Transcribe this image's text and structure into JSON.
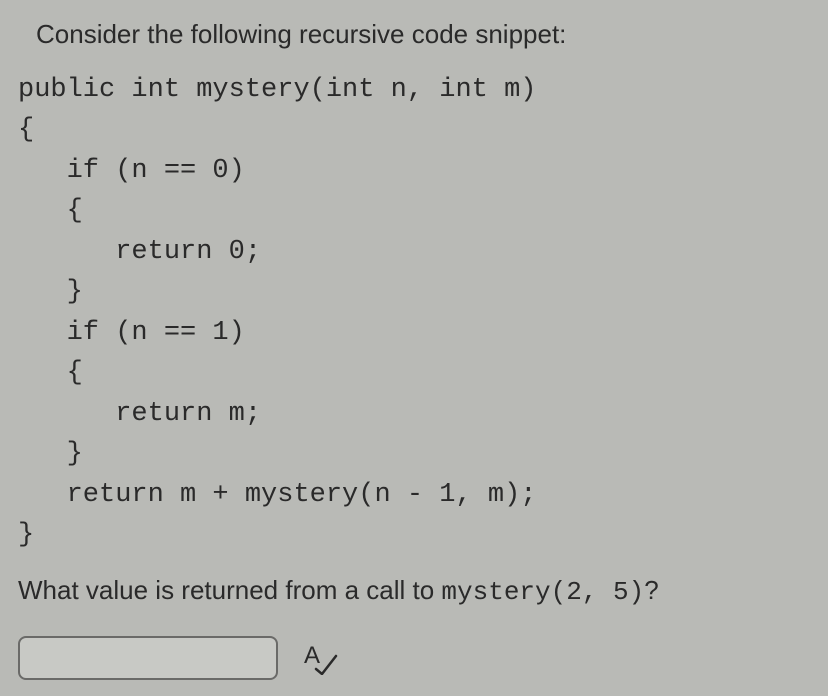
{
  "intro": "Consider the following recursive code snippet:",
  "code": "public int mystery(int n, int m)\n{\n   if (n == 0)\n   {\n      return 0;\n   }\n   if (n == 1)\n   {\n      return m;\n   }\n   return m + mystery(n - 1, m);\n}",
  "question_prefix": "What value is returned from a call to ",
  "question_code": "mystery(2, 5)",
  "question_suffix": "?",
  "answer_value": ""
}
